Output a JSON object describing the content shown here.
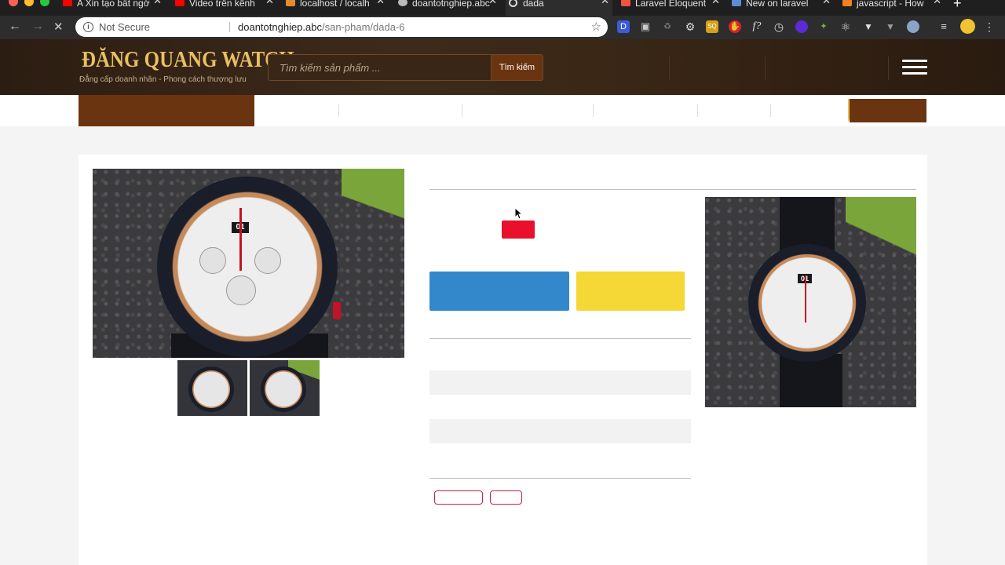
{
  "browser": {
    "tabs": [
      {
        "title": "A Xin tạo bất ngờ",
        "icon": "youtube-icon"
      },
      {
        "title": "Video trên kênh",
        "icon": "youtube-icon"
      },
      {
        "title": "localhost / localh",
        "icon": "phpmyadmin-icon"
      },
      {
        "title": "doantotnghiep.abc",
        "icon": "site-icon"
      },
      {
        "title": "dada",
        "icon": "loading-icon",
        "active": true
      },
      {
        "title": "Laravel Eloquent",
        "icon": "laravel-icon"
      },
      {
        "title": "New on laravel",
        "icon": "tab-icon"
      },
      {
        "title": "javascript - How",
        "icon": "stackoverflow-icon"
      }
    ],
    "address": {
      "security": "Not Secure",
      "host": "doantotnghiep.abc",
      "path": "/san-pham/dada-6"
    }
  },
  "site": {
    "logo_title": "ĐĂNG QUANG WATCH",
    "logo_subtitle": "Đẳng cấp doanh nhân - Phong cách thượng lưu",
    "search_placeholder": "Tìm kiếm sản phẩm ...",
    "search_button": "Tìm kiếm"
  },
  "product": {
    "main_image": "watch-photo",
    "thumbnails": [
      "watch-thumb-1",
      "watch-thumb-2"
    ],
    "side_image": "watch-photo-side"
  },
  "colors": {
    "brand_brown": "#6b3410",
    "gold": "#e8c061",
    "accent_red": "#e8102a",
    "blue_button": "#3388cc",
    "yellow_button": "#f5d735"
  }
}
